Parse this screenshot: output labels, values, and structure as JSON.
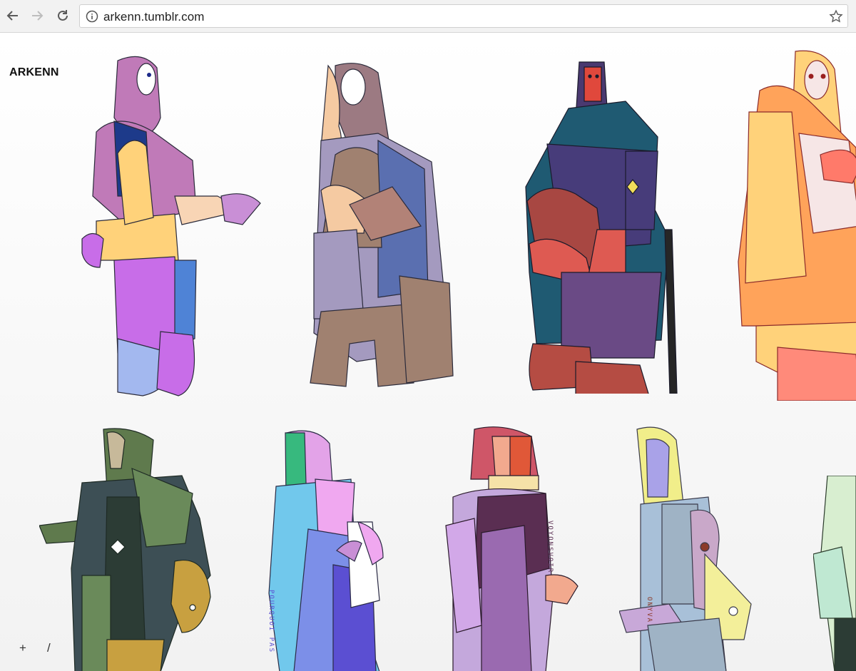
{
  "browser": {
    "url": "arkenn.tumblr.com"
  },
  "blog": {
    "title": "ARKENN",
    "add_button": "+",
    "slash_button": "/"
  },
  "artwork_labels": {
    "pourquoi_pas": "POURQUOI PAS",
    "voyonsvoir": "VOYONSVOIR",
    "onyva": "ONYVA"
  },
  "colors": {
    "chrome": "#f2f2f2",
    "purple": "#c07ab8",
    "yellow": "#ffd27a",
    "blue": "#5a6fb0",
    "red": "#c9463d",
    "teal": "#1f5a72",
    "green": "#5f7a4d",
    "lavender": "#c98fd6"
  }
}
